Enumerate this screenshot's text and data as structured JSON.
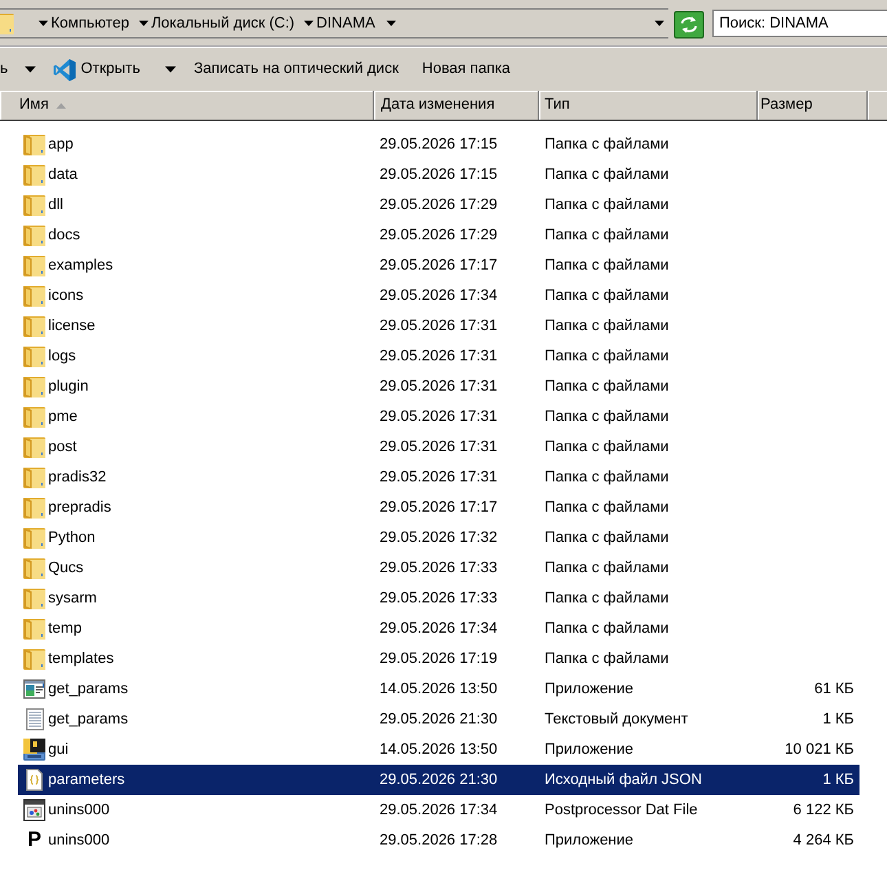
{
  "address_bar": {
    "breadcrumbs": [
      {
        "label": "Компьютер"
      },
      {
        "label": "Локальный диск (C:)"
      },
      {
        "label": "DINAMA"
      }
    ]
  },
  "search": {
    "placeholder": "Поиск: DINAMA"
  },
  "toolbar": [
    {
      "label": "ь",
      "kind": "menu"
    },
    {
      "label": "Открыть",
      "kind": "open-menu"
    },
    {
      "label": "Записать на оптический диск",
      "kind": "button"
    },
    {
      "label": "Новая папка",
      "kind": "button"
    }
  ],
  "columns": [
    {
      "label": "Имя",
      "sorted": true
    },
    {
      "label": "Дата изменения",
      "sorted": false
    },
    {
      "label": "Тип",
      "sorted": false
    },
    {
      "label": "Размер",
      "sorted": false
    }
  ],
  "rows": [
    {
      "name": "app",
      "date": "29.05.2026 17:15",
      "type": "Папка с файлами",
      "kind": "folder",
      "selected": false
    },
    {
      "name": "data",
      "date": "29.05.2026 17:15",
      "type": "Папка с файлами",
      "kind": "folder",
      "selected": false
    },
    {
      "name": "dll",
      "date": "29.05.2026 17:29",
      "type": "Папка с файлами",
      "kind": "folder",
      "selected": false
    },
    {
      "name": "docs",
      "date": "29.05.2026 17:29",
      "type": "Папка с файлами",
      "kind": "folder",
      "selected": false
    },
    {
      "name": "examples",
      "date": "29.05.2026 17:17",
      "type": "Папка с файлами",
      "kind": "folder",
      "selected": false
    },
    {
      "name": "icons",
      "date": "29.05.2026 17:34",
      "type": "Папка с файлами",
      "kind": "folder",
      "selected": false
    },
    {
      "name": "license",
      "date": "29.05.2026 17:31",
      "type": "Папка с файлами",
      "kind": "folder",
      "selected": false
    },
    {
      "name": "logs",
      "date": "29.05.2026 17:31",
      "type": "Папка с файлами",
      "kind": "folder",
      "selected": false
    },
    {
      "name": "plugin",
      "date": "29.05.2026 17:31",
      "type": "Папка с файлами",
      "kind": "folder",
      "selected": false
    },
    {
      "name": "pme",
      "date": "29.05.2026 17:31",
      "type": "Папка с файлами",
      "kind": "folder",
      "selected": false
    },
    {
      "name": "post",
      "date": "29.05.2026 17:31",
      "type": "Папка с файлами",
      "kind": "folder",
      "selected": false
    },
    {
      "name": "pradis32",
      "date": "29.05.2026 17:31",
      "type": "Папка с файлами",
      "kind": "folder",
      "selected": false
    },
    {
      "name": "prepradis",
      "date": "29.05.2026 17:17",
      "type": "Папка с файлами",
      "kind": "folder",
      "selected": false
    },
    {
      "name": "Python",
      "date": "29.05.2026 17:32",
      "type": "Папка с файлами",
      "kind": "folder",
      "selected": false
    },
    {
      "name": "Qucs",
      "date": "29.05.2026 17:33",
      "type": "Папка с файлами",
      "kind": "folder",
      "selected": false
    },
    {
      "name": "sysarm",
      "date": "29.05.2026 17:33",
      "type": "Папка с файлами",
      "kind": "folder",
      "selected": false
    },
    {
      "name": "temp",
      "date": "29.05.2026 17:34",
      "type": "Папка с файлами",
      "kind": "folder",
      "selected": false
    },
    {
      "name": "templates",
      "date": "29.05.2026 17:19",
      "type": "Папка с файлами",
      "kind": "folder",
      "selected": false
    },
    {
      "name": "get_params",
      "date": "14.05.2026 13:50",
      "type": "Приложение",
      "size": "61 КБ",
      "kind": "exe",
      "selected": false
    },
    {
      "name": "get_params",
      "date": "29.05.2026 21:30",
      "type": "Текстовый документ",
      "size": "1 КБ",
      "kind": "text",
      "selected": false
    },
    {
      "name": "gui",
      "date": "14.05.2026 13:50",
      "type": "Приложение",
      "size": "10 021 КБ",
      "kind": "exe-gui",
      "selected": false
    },
    {
      "name": "parameters",
      "date": "29.05.2026 21:30",
      "type": "Исходный файл JSON",
      "size": "1 КБ",
      "kind": "json",
      "selected": true
    },
    {
      "name": "unins000",
      "date": "29.05.2026 17:34",
      "type": "Postprocessor Dat File",
      "size": "6 122 КБ",
      "kind": "dat",
      "selected": false
    },
    {
      "name": "unins000",
      "date": "29.05.2026 17:28",
      "type": "Приложение",
      "size": "4 264 КБ",
      "kind": "glyph",
      "icon_glyph": "P",
      "selected": false
    }
  ]
}
